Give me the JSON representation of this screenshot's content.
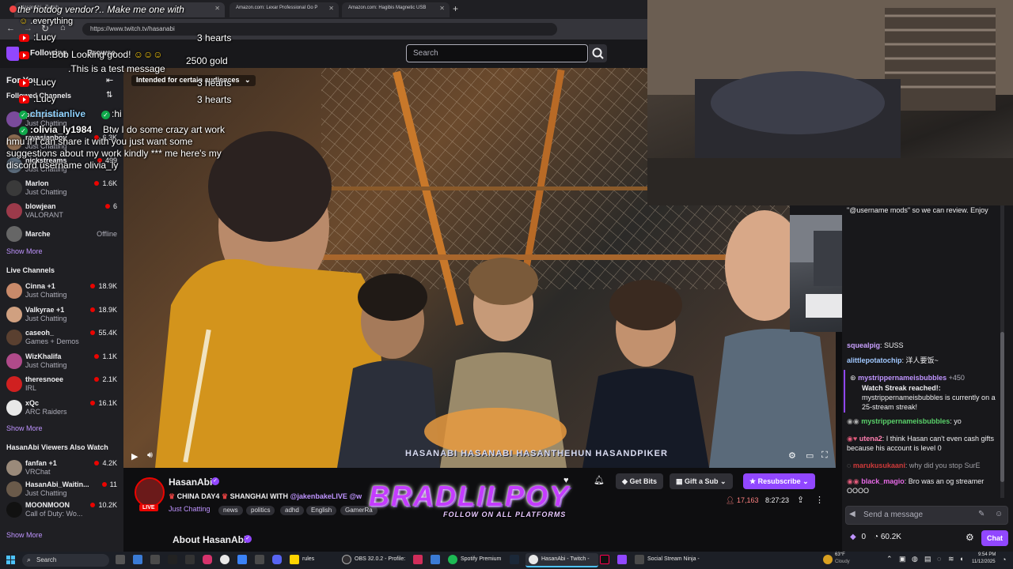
{
  "browser": {
    "tabs": [
      {
        "label": "HasanAbi - Twitch",
        "active": true
      },
      {
        "label": "Amazon.com: Lexar Professional Go P"
      },
      {
        "label": "Amazon.com: Hagibis Magnetic USB"
      }
    ],
    "url": "https://www.twitch.tv/hasanabi"
  },
  "twitch": {
    "search_placeholder": "Search",
    "audience_label": "Intended for certain audiences",
    "sidebar": {
      "for_you_title": "For You",
      "followed_title": "Followed Channels",
      "followed": [
        {
          "name": "pixelpainter",
          "game": "Just Chatting",
          "viewers": "",
          "color": "#7a4b9c"
        },
        {
          "name": "rayasianboy",
          "game": "Just Chatting",
          "viewers": "6.3K",
          "color": "#8a6a50"
        },
        {
          "name": "nickstreams",
          "game": "Just Chatting",
          "viewers": "499",
          "color": "#5a6a7a"
        },
        {
          "name": "Marlon",
          "game": "Just Chatting",
          "viewers": "1.6K",
          "color": "#3a3a3a"
        },
        {
          "name": "blowjean",
          "game": "VALORANT",
          "viewers": "6",
          "color": "#9c3a4a"
        },
        {
          "name": "Marche",
          "game": "",
          "viewers": "Offline",
          "color": "#666666"
        }
      ],
      "show_more_1": "Show More",
      "live_title": "Live Channels",
      "live": [
        {
          "name": "Cinna +1",
          "game": "Just Chatting",
          "viewers": "18.9K",
          "color": "#c98a6a"
        },
        {
          "name": "Valkyrae +1",
          "game": "Just Chatting",
          "viewers": "18.9K",
          "color": "#d0a080"
        },
        {
          "name": "caseoh_",
          "game": "Games + Demos",
          "viewers": "55.4K",
          "color": "#5a4030"
        },
        {
          "name": "WizKhalifa",
          "game": "Just Chatting",
          "viewers": "1.1K",
          "color": "#b04a8a"
        },
        {
          "name": "theresnoee",
          "game": "IRL",
          "viewers": "2.1K",
          "color": "#d02020"
        },
        {
          "name": "xQc",
          "game": "ARC Raiders",
          "viewers": "16.1K",
          "color": "#e8e8e8"
        }
      ],
      "show_more_2": "Show More",
      "also_watch_title": "HasanAbi Viewers Also Watch",
      "also_watch": [
        {
          "name": "fanfan +1",
          "game": "VRChat",
          "viewers": "4.2K",
          "color": "#9a8a7a"
        },
        {
          "name": "HasanAbi_Waitin...",
          "game": "Just Chatting",
          "viewers": "11",
          "color": "#6a5a4a"
        },
        {
          "name": "MOONMOON",
          "game": "Call of Duty: Wo...",
          "viewers": "10.2K",
          "color": "#111111"
        }
      ],
      "show_more_3": "Show More"
    },
    "channel": {
      "name": "HasanAbi",
      "live_badge": "LIVE",
      "title_prefix": "CHINA DAY4",
      "title_mid": "SHANGHAI WITH",
      "title_mention": "@jakenbakeLIVE",
      "title_suffix": "@w",
      "category": "Just Chatting",
      "tags": [
        "news",
        "politics",
        "adhd",
        "English",
        "GamerRa"
      ],
      "viewers": "17,163",
      "uptime": "8:27:23",
      "about": "About HasanAbi",
      "get_bits": "Get Bits",
      "gift_sub": "Gift a Sub",
      "resubscribe": "Resubscribe"
    },
    "stream_banner": "HASANABI  HASANABI  HASANTHEHUN  HASANDPIKER",
    "chat": {
      "notice": "\"@username mods\" so we can review. Enjoy",
      "messages": [
        {
          "user": "squealpig",
          "text": ": SUSS",
          "color": "#c9a0ff"
        },
        {
          "user": "alittlepotatochip",
          "text": ": 洋人要饭~",
          "color": "#a0c8ff"
        },
        {
          "user": "mystrippernameisbubbles",
          "text": "+450",
          "color": "#bf94ff"
        },
        {
          "user": "",
          "text": "Watch Streak reached!:",
          "color": "#efeff1"
        },
        {
          "user": "",
          "text": "mystrippernameisbubbles is currently on a 25-stream streak!",
          "color": "#efeff1"
        },
        {
          "user": "mystrippernameisbubbles",
          "text": ": yo",
          "color": "#5ad16a"
        },
        {
          "user": "utena2",
          "text": ": I think Hasan can't even cash gifts because his account is level 0",
          "color": "#ff7fb0"
        },
        {
          "user": "marukusukaani",
          "text": ": why did you stop SurE",
          "color": "#d03a3a"
        },
        {
          "user": "black_magio",
          "text": ": Bro was an og streamer OOOO",
          "color": "#e86ae8"
        }
      ],
      "send_placeholder": "Send a message",
      "points": "0",
      "channel_points": "60.2K",
      "chat_button": "Chat"
    }
  },
  "overlay": {
    "top_text": "the hotdog vendor?.. Make me one with",
    "everything": ".everything",
    "lines": [
      {
        "user": ":Lucy",
        "text": ""
      },
      {
        "user": ":Bob",
        "text": "Looking good!"
      },
      {
        "user": "",
        "text": ".This is a test message"
      },
      {
        "user": ":Lucy",
        "text": ""
      },
      {
        "user": ":Lucy",
        "text": ""
      }
    ],
    "hearts_1": "3 hearts",
    "gold": "2500 gold",
    "hearts_2": "3 hearts",
    "hearts_3": "3 hearts",
    "chat1_user": "christianlive",
    "chat1_text": ":hi",
    "chat2_user": ":olivia_ly1984",
    "chat2_text": "Btw I do some crazy art work hmu if I can share it with you just want some suggestions about my work kindly *** me here's my discord username olivia_ly",
    "banner_big": "BRADLILPOY",
    "banner_small": "FOLLOW ON ALL PLATFORMS"
  },
  "taskbar": {
    "search": "Search",
    "items": [
      "rules",
      "OBS 32.0.2 - Profile:",
      "Spotify Premium",
      "HasanAbi - Twitch -",
      "Social Stream Ninja -"
    ],
    "weather_temp": "63°F",
    "weather_desc": "Cloudy",
    "time": "9:54 PM",
    "date": "11/12/2025"
  },
  "colors": {
    "twitch_purple": "#9147ff",
    "live_red": "#eb0400",
    "link_purple": "#bf94ff"
  }
}
